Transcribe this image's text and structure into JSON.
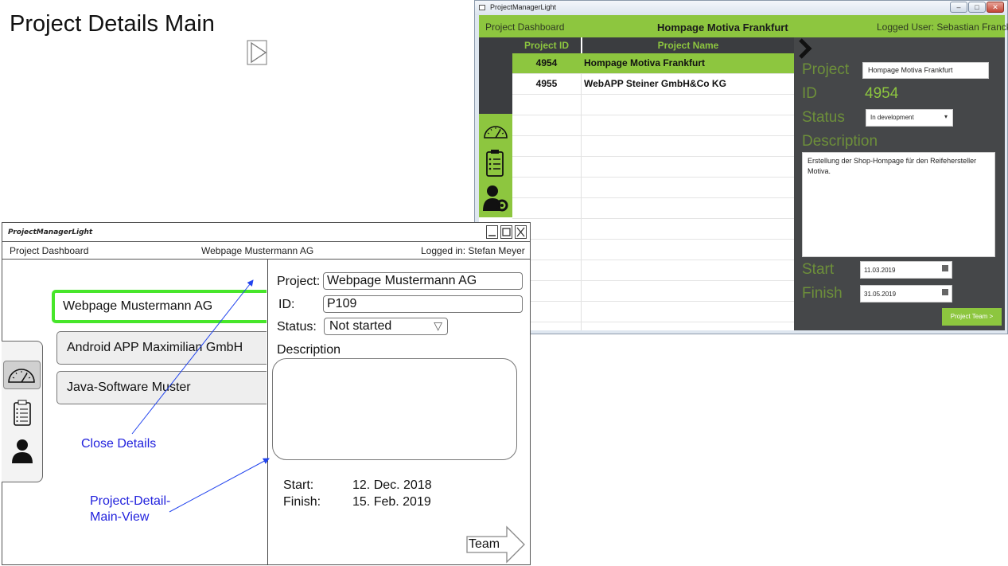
{
  "slide_title": "Project Details Main",
  "app_window": {
    "title": "ProjectManagerLight",
    "controls": {
      "minimize": "–",
      "maximize": "□",
      "close": "✕"
    },
    "header": {
      "dashboard": "Project Dashboard",
      "project": "Hompage Motiva Frankfurt",
      "user": "Logged User: Sebastian Franck"
    },
    "table": {
      "columns": [
        "Project ID",
        "Project Name"
      ],
      "rows": [
        {
          "id": "4954",
          "name": "Hompage Motiva Frankfurt",
          "selected": true
        },
        {
          "id": "4955",
          "name": "WebAPP Steiner GmbH&Co KG",
          "selected": false
        }
      ]
    },
    "detail": {
      "project_label": "Project",
      "project_value": "Hompage Motiva Frankfurt",
      "id_label": "ID",
      "id_value": "4954",
      "status_label": "Status",
      "status_value": "In development",
      "description_label": "Description",
      "description_value": "Erstellung der Shop-Hompage für den Reifehersteller Motiva.",
      "start_label": "Start",
      "start_value": "11.03.2019",
      "finish_label": "Finish",
      "finish_value": "31.05.2019",
      "team_button": "Project Team >"
    },
    "colors": {
      "accent": "#8dc63f",
      "dark": "#3b3d40",
      "panel": "#454749"
    }
  },
  "wireframe": {
    "title": "ProjectManagerLight",
    "header": {
      "dashboard": "Project Dashboard",
      "project": "Webpage Mustermann AG",
      "user": "Logged in: Stefan Meyer"
    },
    "projects": [
      {
        "name": "Webpage Mustermann AG",
        "selected": true
      },
      {
        "name": "Android APP Maximilian GmbH",
        "selected": false
      },
      {
        "name": "Java-Software Muster",
        "selected": false
      }
    ],
    "detail": {
      "project_label": "Project:",
      "project_value": "Webpage Mustermann AG",
      "id_label": "ID:",
      "id_value": "P109",
      "status_label": "Status:",
      "status_value": "Not started",
      "description_label": "Description",
      "start_label": "Start:",
      "start_value": "12. Dec. 2018",
      "finish_label": "Finish:",
      "finish_value": "15. Feb. 2019",
      "team_button": "Team"
    },
    "colors": {
      "selected_border": "#47e62a"
    }
  },
  "annotations": {
    "close_details": "Close Details",
    "main_view_line1": "Project-Detail-",
    "main_view_line2": "Main-View",
    "color": "#2222dd"
  },
  "icons": [
    "speedometer-icon",
    "clipboard-icon",
    "user-gear-icon",
    "user-icon",
    "chevron-right-icon",
    "dropdown-arrow-icon",
    "calendar-icon"
  ]
}
